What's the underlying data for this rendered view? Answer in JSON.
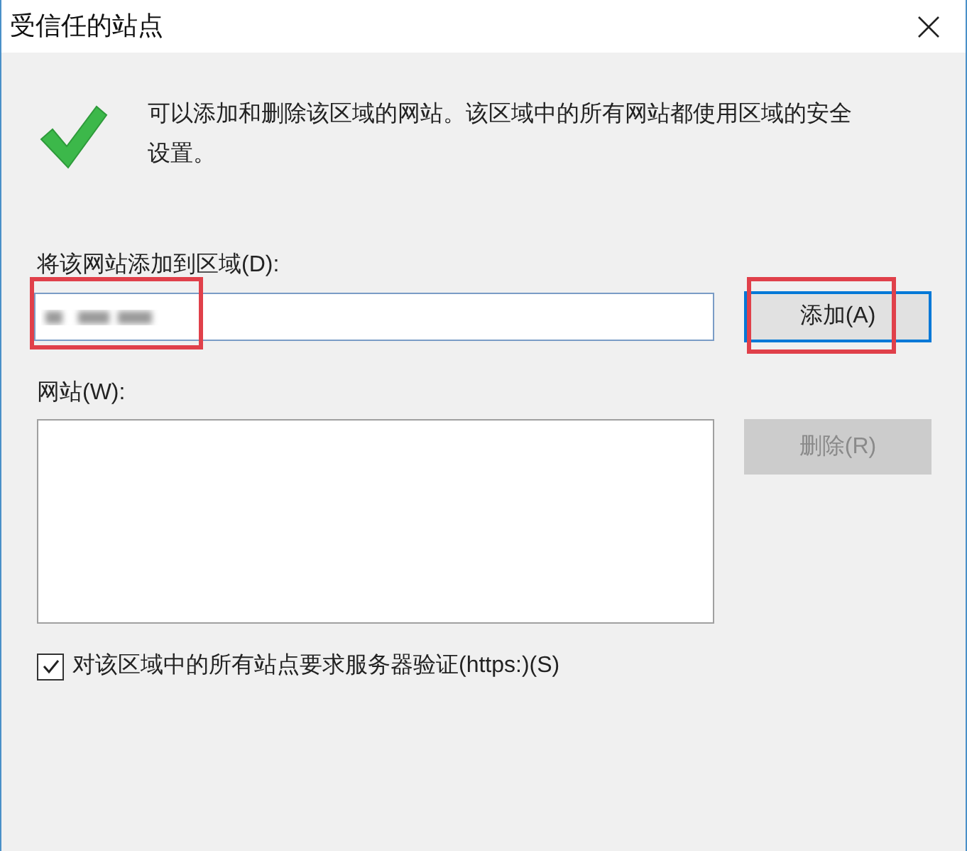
{
  "window": {
    "title": "受信任的站点"
  },
  "message": "可以添加和删除该区域的网站。该区域中的所有网站都使用区域的安全设置。",
  "add_field": {
    "label": "将该网站添加到区域(D):",
    "highlighted": true
  },
  "add_button": {
    "label": "添加(A)",
    "highlighted": true,
    "disabled": false
  },
  "websites": {
    "label": "网站(W):"
  },
  "remove_button": {
    "label": "删除(R)",
    "disabled": true
  },
  "https_checkbox": {
    "label": "对该区域中的所有站点要求服务器验证(https:)(S)",
    "checked": true
  }
}
